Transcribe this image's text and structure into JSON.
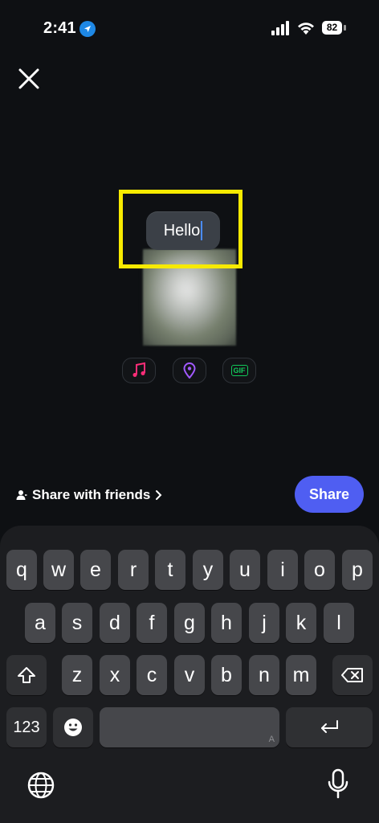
{
  "status_bar": {
    "time": "2:41",
    "battery": "82"
  },
  "text_sticker": {
    "value": "Hello"
  },
  "chips": {
    "music_icon": "music-note-icon",
    "location_icon": "location-pin-icon",
    "gif_label": "GIF"
  },
  "share_bar": {
    "share_with_friends": "Share with friends",
    "share_button": "Share"
  },
  "keyboard": {
    "row1": [
      "q",
      "w",
      "e",
      "r",
      "t",
      "y",
      "u",
      "i",
      "o",
      "p"
    ],
    "row2": [
      "a",
      "s",
      "d",
      "f",
      "g",
      "h",
      "j",
      "k",
      "l"
    ],
    "row3": [
      "z",
      "x",
      "c",
      "v",
      "b",
      "n",
      "m"
    ],
    "numbers_key": "123",
    "space_hint": "A"
  },
  "colors": {
    "highlight": "#f7ea00",
    "share_button": "#4f5ef2",
    "music": "#ff2d78",
    "location": "#a259ff",
    "gif": "#12c85a"
  }
}
